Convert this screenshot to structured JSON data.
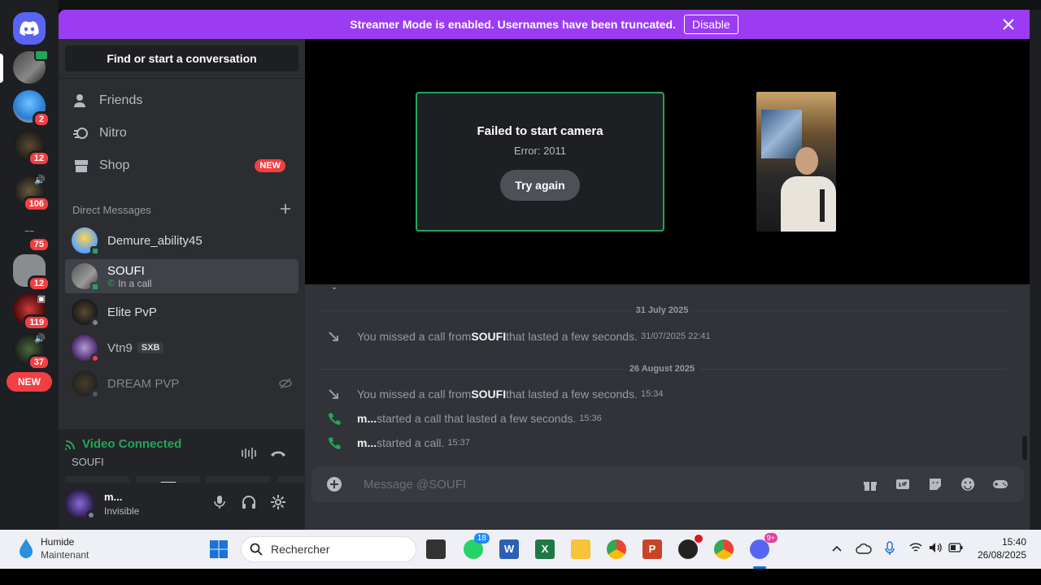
{
  "banner": {
    "text": "Streamer Mode is enabled. Usernames have been truncated.",
    "button": "Disable"
  },
  "rail": {
    "badges": [
      "2",
      "12",
      "106",
      "75",
      "12",
      "119",
      "37"
    ],
    "new_label": "NEW"
  },
  "sidebar": {
    "search_label": "Find or start a conversation",
    "nav": [
      {
        "label": "Friends"
      },
      {
        "label": "Nitro"
      },
      {
        "label": "Shop",
        "tag": "NEW"
      }
    ],
    "dm_header": "Direct Messages",
    "dms": [
      {
        "name": "Demure_ability45",
        "status": "online"
      },
      {
        "name": "SOUFI",
        "sub": "In a call",
        "status": "online"
      },
      {
        "name": "Elite PvP",
        "status": "offline"
      },
      {
        "name": "Vtn9",
        "tag": "SXB",
        "status": "dnd"
      },
      {
        "name": "DREAM PVP",
        "status": "offline"
      }
    ]
  },
  "voice": {
    "title": "Video Connected",
    "channel": "SOUFI"
  },
  "user": {
    "name": "m...",
    "status": "Invisible"
  },
  "call": {
    "error_title": "Failed to start camera",
    "error_code": "Error: 2011",
    "retry": "Try again"
  },
  "messages": {
    "date1": "31 July 2025",
    "m1": {
      "pre": "You missed a call from ",
      "who": "SOUFI",
      "post": " that lasted a few seconds.",
      "ts": "31/07/2025 22:41"
    },
    "date2": "26 August 2025",
    "m2": {
      "pre": "You missed a call from ",
      "who": "SOUFI",
      "post": " that lasted a few seconds.",
      "ts": "15:34"
    },
    "m3": {
      "who": "m...",
      "post": " started a call that lasted a few seconds.",
      "ts": "15:36"
    },
    "m4": {
      "who": "m...",
      "post": " started a call.",
      "ts": "15:37"
    }
  },
  "composer": {
    "placeholder": "Message @SOUFI"
  },
  "taskbar": {
    "weather_title": "Humide",
    "weather_sub": "Maintenant",
    "search": "Rechercher",
    "whatsapp_badge": "18",
    "discord_badge": "9+",
    "time": "15:40",
    "date": "26/08/2025"
  },
  "colors": {
    "accent": "#9b3cf2",
    "green": "#23a55a",
    "red": "#f23f43",
    "blurple": "#5865f2"
  }
}
